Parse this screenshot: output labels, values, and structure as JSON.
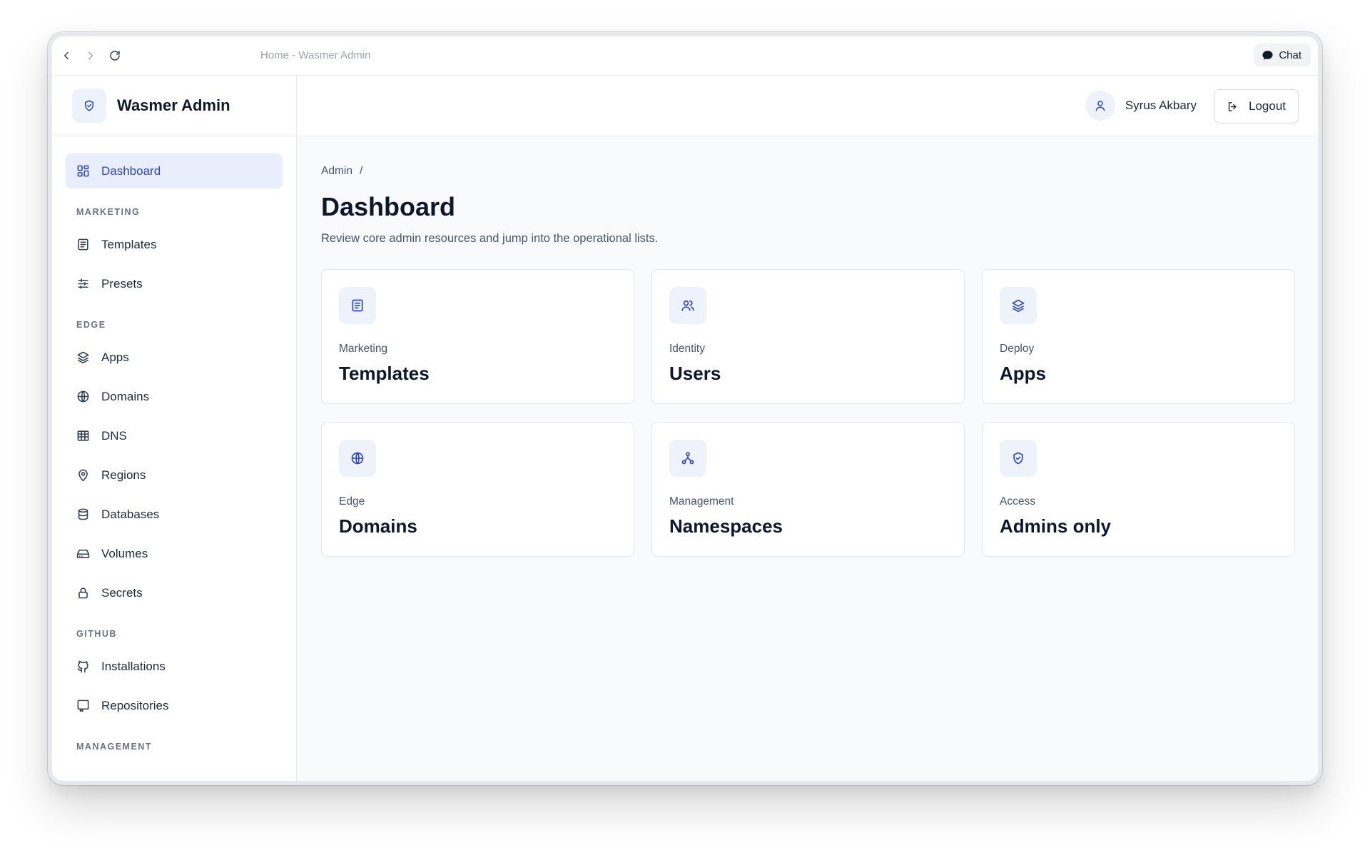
{
  "browser": {
    "url": "Home - Wasmer Admin",
    "chat_label": "Chat"
  },
  "brand": {
    "title": "Wasmer Admin"
  },
  "sidebar": {
    "dashboard": "Dashboard",
    "marketing_label": "MARKETING",
    "marketing": [
      "Templates",
      "Presets"
    ],
    "edge_label": "EDGE",
    "edge": [
      "Apps",
      "Domains",
      "DNS",
      "Regions",
      "Databases",
      "Volumes",
      "Secrets"
    ],
    "github_label": "GITHUB",
    "github": [
      "Installations",
      "Repositories"
    ],
    "management_label": "MANAGEMENT"
  },
  "header": {
    "user_name": "Syrus Akbary",
    "logout_label": "Logout"
  },
  "main": {
    "breadcrumb_root": "Admin",
    "breadcrumb_sep": "/",
    "title": "Dashboard",
    "description": "Review core admin resources and jump into the operational lists.",
    "cards": [
      {
        "category": "Marketing",
        "title": "Templates",
        "icon": "document-icon"
      },
      {
        "category": "Identity",
        "title": "Users",
        "icon": "users-icon"
      },
      {
        "category": "Deploy",
        "title": "Apps",
        "icon": "layers-icon"
      },
      {
        "category": "Edge",
        "title": "Domains",
        "icon": "globe-icon"
      },
      {
        "category": "Management",
        "title": "Namespaces",
        "icon": "network-icon"
      },
      {
        "category": "Access",
        "title": "Admins only",
        "icon": "shield-icon"
      }
    ]
  },
  "colors": {
    "accent": "#2f45c5",
    "active_bg": "#e8eefc",
    "icon_bg": "#eef2fb"
  }
}
